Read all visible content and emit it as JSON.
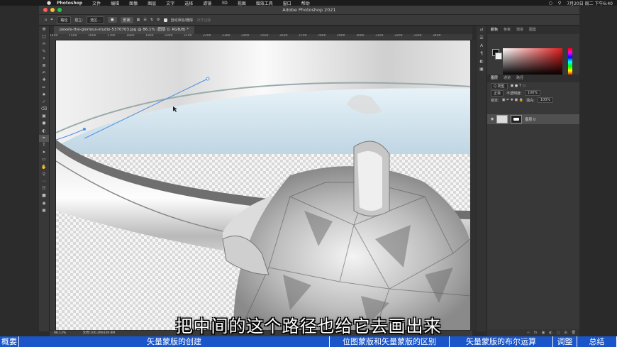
{
  "menubar": {
    "apple": "",
    "items": [
      "Photoshop",
      "文件",
      "编辑",
      "图像",
      "图层",
      "文字",
      "选择",
      "滤镜",
      "3D",
      "视图",
      "增效工具",
      "窗口",
      "帮助"
    ],
    "clock": "7月20日 周二 下午6:40"
  },
  "window": {
    "title": "Adobe Photoshop 2021"
  },
  "options": {
    "tool_mode": "路径",
    "make_label": "建立:",
    "make_dd": "选区...",
    "shape_btn": "形状",
    "auto_label": "自动添加/删除",
    "align_label": "对齐边缘"
  },
  "document": {
    "tab": "pexels-the-glorious-studio-5370703.jpg @ 86.1% (图层 0, RGB/8) *",
    "ruler_ticks": [
      "1400",
      "1500",
      "1600",
      "1700",
      "1800",
      "1900",
      "2000",
      "2100",
      "2200",
      "2300",
      "2400",
      "2500",
      "2600",
      "2700",
      "2800",
      "2900",
      "3000",
      "3100",
      "3200",
      "3300",
      "3400"
    ],
    "zoom": "86.13%",
    "doc_size": "文档:100.2M/439.9M"
  },
  "panels": {
    "color_tabs": [
      "颜色",
      "色板",
      "渐变",
      "图案"
    ],
    "layer_tabs": [
      "图层",
      "通道",
      "路径"
    ],
    "kind_dd": "Q 类型",
    "blend_dd": "正常",
    "opacity_label": "不透明度:",
    "opacity_value": "100%",
    "lock_label": "锁定:",
    "fill_label": "填充:",
    "fill_value": "100%",
    "layer_name": "图层 0",
    "footer_icons": "fx"
  },
  "subtitle": "把中间的这个路径也给它去画出来",
  "chapters": [
    "概要",
    "矢量蒙版的创建",
    "位图蒙版和矢量蒙版的区别",
    "矢量蒙版的布尔运算",
    "调整",
    "总结"
  ],
  "colors": {
    "chapter_bar": "#1a56c9",
    "chapter_active": "#0f2f8f",
    "path": "#4a90e2"
  }
}
